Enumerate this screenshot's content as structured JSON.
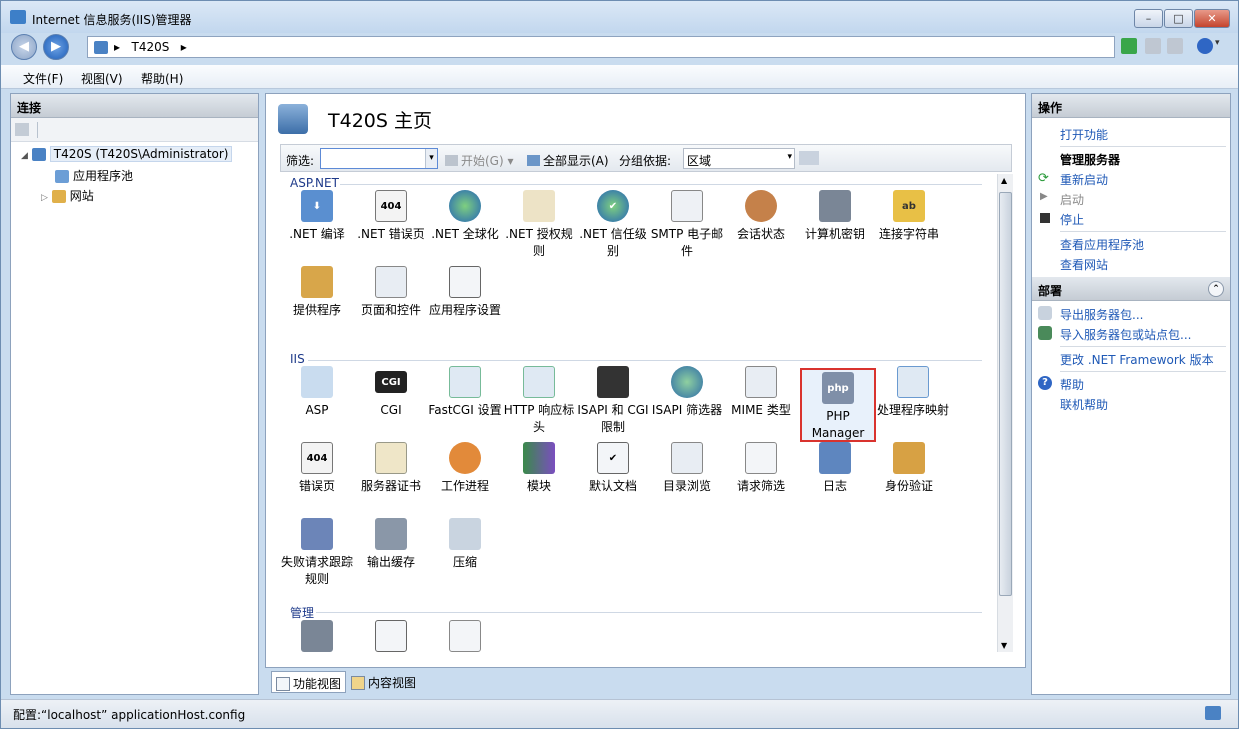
{
  "window": {
    "title": "Internet 信息服务(IIS)管理器",
    "controls": [
      "minimize",
      "maximize",
      "close"
    ]
  },
  "address": {
    "crumbs": [
      "▸",
      "T420S",
      "▸"
    ]
  },
  "menu": [
    "文件(F)",
    "视图(V)",
    "帮助(H)"
  ],
  "connections": {
    "title": "连接",
    "tree": [
      {
        "label": "T420S (T420S\\Administrator)",
        "level": 0,
        "expander": "◢"
      },
      {
        "label": "应用程序池",
        "level": 1,
        "expander": ""
      },
      {
        "label": "网站",
        "level": 1,
        "expander": "▷"
      }
    ]
  },
  "center": {
    "title": "T420S 主页",
    "filter_label": "筛选:",
    "filter_value": "",
    "start_label": "开始(G)",
    "show_all_label": "全部显示(A)",
    "group_by_label": "分组依据:",
    "group_by_value": "区域",
    "categories": [
      {
        "name": "ASP.NET",
        "features": [
          {
            "label": ".NET 编译",
            "icon": "download-arrow-icon"
          },
          {
            "label": ".NET 错误页",
            "icon": "warning-404-icon"
          },
          {
            "label": ".NET 全球化",
            "icon": "globe-icon"
          },
          {
            "label": ".NET 授权规则",
            "icon": "lock-document-icon"
          },
          {
            "label": ".NET 信任级别",
            "icon": "globe-check-icon"
          },
          {
            "label": "SMTP 电子邮件",
            "icon": "mail-icon"
          },
          {
            "label": "会话状态",
            "icon": "user-session-icon"
          },
          {
            "label": "计算机密钥",
            "icon": "server-key-icon"
          },
          {
            "label": "连接字符串",
            "icon": "database-ab-icon"
          },
          {
            "label": "提供程序",
            "icon": "provider-user-icon"
          },
          {
            "label": "页面和控件",
            "icon": "page-controls-icon"
          },
          {
            "label": "应用程序设置",
            "icon": "settings-list-icon"
          }
        ]
      },
      {
        "name": "IIS",
        "features": [
          {
            "label": "ASP",
            "icon": "asp-gear-icon"
          },
          {
            "label": "CGI",
            "icon": "cgi-icon"
          },
          {
            "label": "FastCGI 设置",
            "icon": "fastcgi-icon"
          },
          {
            "label": "HTTP 响应标头",
            "icon": "http-header-icon"
          },
          {
            "label": "ISAPI 和 CGI 限制",
            "icon": "isapi-cgi-restrict-icon"
          },
          {
            "label": "ISAPI 筛选器",
            "icon": "isapi-filter-icon"
          },
          {
            "label": "MIME 类型",
            "icon": "mime-icon"
          },
          {
            "label": "PHP Manager",
            "icon": "php-icon"
          },
          {
            "label": "处理程序映射",
            "icon": "handler-mapping-icon"
          },
          {
            "label": "错误页",
            "icon": "warning-404-icon"
          },
          {
            "label": "服务器证书",
            "icon": "certificate-icon"
          },
          {
            "label": "工作进程",
            "icon": "worker-process-icon"
          },
          {
            "label": "模块",
            "icon": "modules-icon"
          },
          {
            "label": "默认文档",
            "icon": "default-document-icon"
          },
          {
            "label": "目录浏览",
            "icon": "directory-browse-icon"
          },
          {
            "label": "请求筛选",
            "icon": "request-filter-icon"
          },
          {
            "label": "日志",
            "icon": "log-icon"
          },
          {
            "label": "身份验证",
            "icon": "authentication-icon"
          },
          {
            "label": "失败请求跟踪规则",
            "icon": "failed-request-icon"
          },
          {
            "label": "输出缓存",
            "icon": "output-cache-icon"
          },
          {
            "label": "压缩",
            "icon": "compression-icon"
          }
        ]
      },
      {
        "name": "管理",
        "features": [
          {
            "label": "",
            "icon": "management-server-icon"
          },
          {
            "label": "",
            "icon": "management-list-icon"
          },
          {
            "label": "",
            "icon": "management-doc-icon"
          }
        ]
      }
    ],
    "php_logo_text": "php",
    "cgi_text": "CGI",
    "err_code": "404"
  },
  "tabs": {
    "features_view": "功能视图",
    "content_view": "内容视图"
  },
  "actions": {
    "title": "操作",
    "open_feature": "打开功能",
    "manage_server": "管理服务器",
    "restart": "重新启动",
    "start": "启动",
    "stop": "停止",
    "view_pools": "查看应用程序池",
    "view_sites": "查看网站",
    "deploy_title": "部署",
    "export_pkg": "导出服务器包...",
    "import_pkg": "导入服务器包或站点包...",
    "change_net": "更改 .NET Framework 版本",
    "help": "帮助",
    "online_help": "联机帮助"
  },
  "status": {
    "text": "配置:“localhost” applicationHost.config"
  }
}
